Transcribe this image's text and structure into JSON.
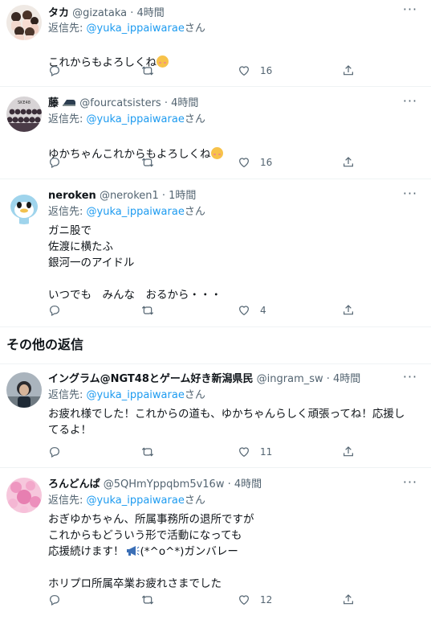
{
  "replies": [
    {
      "name": "タカ",
      "handle": "@gizataka · 4時間",
      "reply_prefix": "返信先: ",
      "mention": "@yuka_ippaiwarae",
      "mention_suffix": "さん",
      "text": "これからもよろしくね",
      "emoji": "smiling-face",
      "reply_count": "",
      "retweet_count": "",
      "like_count": "16"
    },
    {
      "name": "藤",
      "handle": "@fourcatsisters · 4時間",
      "reply_prefix": "返信先: ",
      "mention": "@yuka_ippaiwarae",
      "mention_suffix": "さん",
      "text": "ゆかちゃんこれからもよろしくね",
      "emoji": "smiling-face",
      "reply_count": "",
      "retweet_count": "",
      "like_count": "16"
    },
    {
      "name": "neroken",
      "handle": "@neroken1 · 1時間",
      "reply_prefix": "返信先: ",
      "mention": "@yuka_ippaiwarae",
      "mention_suffix": "さん",
      "text": "ガニ股で\n佐渡に横たふ\n銀河一のアイドル\n\nいつでも　みんな　おるから・・・",
      "reply_count": "",
      "retweet_count": "",
      "like_count": "4"
    }
  ],
  "section_title": "その他の返信",
  "other_replies": [
    {
      "name": "イングラム@NGT48とゲーム好き新潟県民",
      "handle": "@ingram_sw · 4時間",
      "reply_prefix": "返信先: ",
      "mention": "@yuka_ippaiwarae",
      "mention_suffix": "さん",
      "text": "お疲れ様でした！これからの道も、ゆかちゃんらしく頑張ってね！応援し\nてるよ！",
      "reply_count": "",
      "retweet_count": "",
      "like_count": "11"
    },
    {
      "name": "ろんどんぱ",
      "handle": "@5QHmYppqbm5v16w · 4時間",
      "reply_prefix": "返信先: ",
      "mention": "@yuka_ippaiwarae",
      "mention_suffix": "さん",
      "text_line1": "おぎゆかちゃん、所属事務所の退所ですが",
      "text_line2": "これからもどういう形で活動になっても",
      "text_line3a": "応援続けます！",
      "text_line3b": "(*^o^*)ガンバレー",
      "text_line4": "ホリプロ所属卒業お疲れさまでした",
      "reply_count": "",
      "retweet_count": "",
      "like_count": "12"
    }
  ],
  "colors": {
    "accent": "#1d9bf0",
    "secondary_text": "#536471",
    "divider": "#eff3f4"
  },
  "icons": [
    "more-icon",
    "reply-icon",
    "retweet-icon",
    "like-icon",
    "share-icon",
    "megaphone-icon"
  ]
}
